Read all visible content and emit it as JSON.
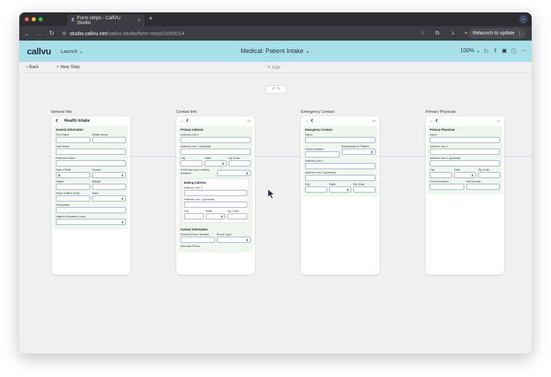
{
  "browser": {
    "tab_title": "Form steps - CallVU Studio",
    "new_tab": "+",
    "url_host": "studio.callvu.net",
    "url_path": "/callvu-studio/form-steps/2000014",
    "relaunch_label": "Relaunch to update"
  },
  "app": {
    "logo": "callvu",
    "launch_label": "Launch",
    "title": "Medical: Patient Intake",
    "zoom": "100%"
  },
  "toolbar": {
    "back_label": "Back",
    "new_step_label": "New Step",
    "edit_label": "Edit"
  },
  "steps": [
    {
      "name": "General Info",
      "brand": "Health Intake",
      "section_title": "General Information",
      "fields": {
        "first_name": "First Name",
        "middle_name": "Middle Name",
        "last_name": "Last Name",
        "preferred_name": "Preferred Name",
        "dob": "Date of Birth",
        "gender": "Gender",
        "height": "Height",
        "weight": "Weight",
        "place_of_birth": "Place of Birth (City)",
        "state": "State",
        "occupation": "Occupation",
        "education": "Highest Education Level"
      }
    },
    {
      "name": "Contact Info",
      "page": "2/4",
      "primary_address": {
        "title": "Primary Address",
        "line1": "Address Line 1",
        "line2": "Address Line 2 (optional)",
        "city": "City",
        "state": "State",
        "zip": "Zip Code",
        "mailing_question": "Is this also your mailing address?"
      },
      "mailing_address": {
        "title": "Mailing Address",
        "line1": "Address Line 1",
        "line2": "Address Line 2 (optional)",
        "city": "City",
        "state": "State",
        "zip": "Zip Code"
      },
      "contact_info": {
        "title": "Contact Information",
        "primary_phone": "Primary Phone Number",
        "phone_type": "Phone Type",
        "alternate_phone": "Alternate Phone"
      }
    },
    {
      "name": "Emergency Contact",
      "page": "3/4",
      "section_title": "Emergency Contact",
      "fields": {
        "name": "Name",
        "phone": "Phone Number",
        "relationship": "Relationship to Patient",
        "line1": "Address Line 1",
        "line2": "Address Line 2 (optional)",
        "city": "City",
        "state": "State",
        "zip": "Zip Code"
      }
    },
    {
      "name": "Primary Physician",
      "page": "4/4",
      "section_title": "Primary Physician",
      "fields": {
        "name": "Name",
        "line1": "Address Line 1",
        "line2": "Address Line 2 (optional)",
        "city": "City",
        "state": "State",
        "zip": "Zip Code",
        "phone": "Phone Number",
        "fax": "Fax Number"
      }
    }
  ]
}
